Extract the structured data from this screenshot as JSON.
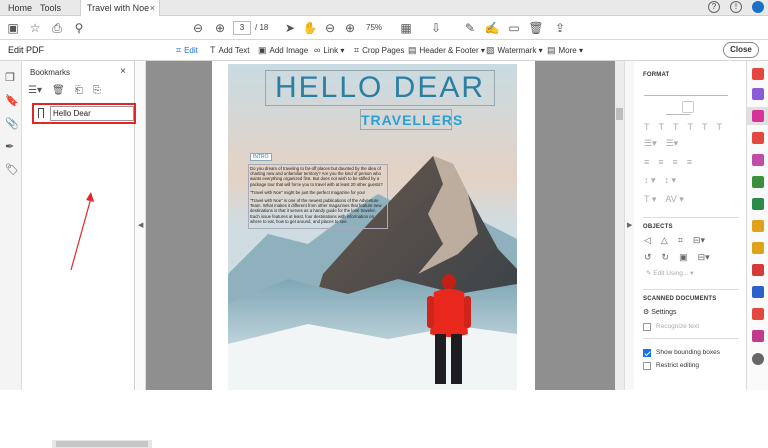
{
  "tabs": {
    "home": "Home",
    "tools": "Tools",
    "doc": "Travel with Noe wit...",
    "close": "×"
  },
  "toolbar": {
    "page_current": "3",
    "page_total": "/  18",
    "zoom": "75%"
  },
  "editbar": {
    "label": "Edit PDF",
    "items": [
      "Edit",
      "Add Text",
      "Add Image",
      "Link",
      "Crop Pages",
      "Header & Footer",
      "Watermark",
      "More"
    ],
    "close": "Close"
  },
  "bookmarks": {
    "title": "Bookmarks",
    "close": "×",
    "item_value": "Hello Dear"
  },
  "cover": {
    "title1": "HELLO DEAR",
    "title2": "TRAVELLERS",
    "intro": "INTRO",
    "p1": "Do you dream of traveling to far-off places but daunted by the idea of charting new and unfamiliar territory? Are you the kind of person who wants everything organized first. But does not wish to be stifled by a package tour that will force you to travel with at least 20 other guests?",
    "p2": "\"Travel with Noe\" might be just the perfect magazine for you!",
    "p3": "\"Travel with Noe\" is one of the newest publications of the Adventure Team. What makes it different from other magazines that feature new destinations is that it serves as a handy guide for the lone traveler. Each issue features at least, four destinations with information on where to eat, how to get around, and places to see."
  },
  "format": {
    "title": "FORMAT"
  },
  "objects": {
    "title": "OBJECTS",
    "edit_using": "Edit Using..."
  },
  "scanned": {
    "title": "SCANNED DOCUMENTS",
    "settings": "Settings",
    "recognize": "Recognize text"
  },
  "options": {
    "bounding": "Show bounding boxes",
    "restrict": "Restrict editing"
  },
  "colors": {
    "accent": "#1473e6",
    "highlight": "#e32626",
    "title": "#2b7fa3",
    "jacket": "#e8281c"
  }
}
